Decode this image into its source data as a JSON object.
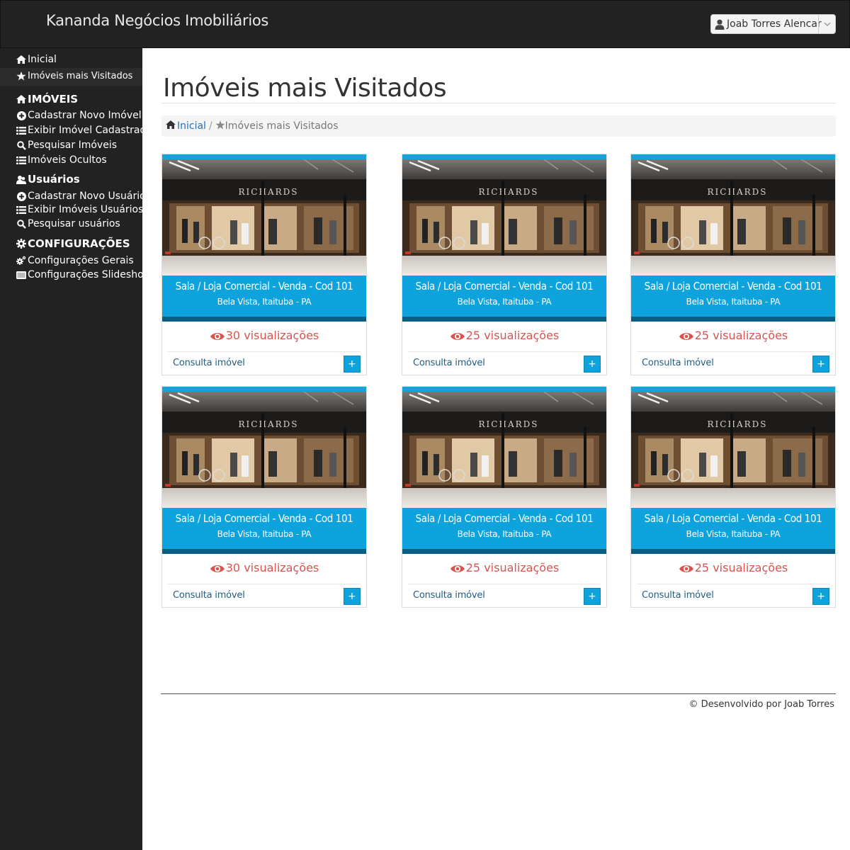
{
  "header": {
    "brand": "Kananda Negócios Imobiliários",
    "user_name": "Joab Torres Alencar"
  },
  "sidebar": {
    "items": [
      {
        "label": "Inicial",
        "icon": "home-icon"
      },
      {
        "label": "Imóveis mais Visitados",
        "icon": "star-icon"
      },
      {
        "label": "IMÓVEIS",
        "icon": "home-icon"
      },
      {
        "label": "Cadastrar Novo Imóvel",
        "icon": "plus-circle-icon"
      },
      {
        "label": "Exibir Imóvel Cadastrados",
        "icon": "list-icon"
      },
      {
        "label": "Pesquisar Imóveis",
        "icon": "search-icon"
      },
      {
        "label": "Imóveis Ocultos",
        "icon": "list-icon"
      },
      {
        "label": "Usuários",
        "icon": "users-icon"
      },
      {
        "label": "Cadastrar Novo Usuário",
        "icon": "plus-circle-icon"
      },
      {
        "label": "Exibir Imóveis Usuários",
        "icon": "list-icon"
      },
      {
        "label": "Pesquisar usuários",
        "icon": "search-icon"
      },
      {
        "label": "CONFIGURAÇÕES",
        "icon": "gear-icon"
      },
      {
        "label": "Configurações Gerais",
        "icon": "gears-icon"
      },
      {
        "label": "Configurações Slideshow",
        "icon": "slideshow-icon"
      }
    ]
  },
  "main": {
    "title": "Imóveis mais Visitados",
    "breadcrumb": {
      "home": "Inicial",
      "separator": "/",
      "current": "Imóveis mais Visitados"
    },
    "cards": [
      {
        "title": "Sala / Loja Comercial - Venda - Cod 101",
        "location": "Bela Vista, Itaituba - PA",
        "views": "30 visualizações",
        "link": "Consulta imóvel",
        "button": "+",
        "store_sign": "RICHARDS"
      },
      {
        "title": "Sala / Loja Comercial - Venda - Cod 101",
        "location": "Bela Vista, Itaituba - PA",
        "views": "25 visualizações",
        "link": "Consulta imóvel",
        "button": "+",
        "store_sign": "RICHARDS"
      },
      {
        "title": "Sala / Loja Comercial - Venda - Cod 101",
        "location": "Bela Vista, Itaituba - PA",
        "views": "25 visualizações",
        "link": "Consulta imóvel",
        "button": "+",
        "store_sign": "RICHARDS"
      },
      {
        "title": "Sala / Loja Comercial - Venda - Cod 101",
        "location": "Bela Vista, Itaituba - PA",
        "views": "30 visualizações",
        "link": "Consulta imóvel",
        "button": "+",
        "store_sign": "RICHARDS"
      },
      {
        "title": "Sala / Loja Comercial - Venda - Cod 101",
        "location": "Bela Vista, Itaituba - PA",
        "views": "25 visualizações",
        "link": "Consulta imóvel",
        "button": "+",
        "store_sign": "RICHARDS"
      },
      {
        "title": "Sala / Loja Comercial - Venda - Cod 101",
        "location": "Bela Vista, Itaituba - PA",
        "views": "25 visualizações",
        "link": "Consulta imóvel",
        "button": "+",
        "store_sign": "RICHARDS"
      }
    ]
  },
  "footer": {
    "text": "© Desenvolvido por Joab Torres"
  },
  "colors": {
    "accent": "#0fa3de",
    "dark_accent": "#0b5f80",
    "views": "#d9534f",
    "sidebar": "#222222"
  }
}
